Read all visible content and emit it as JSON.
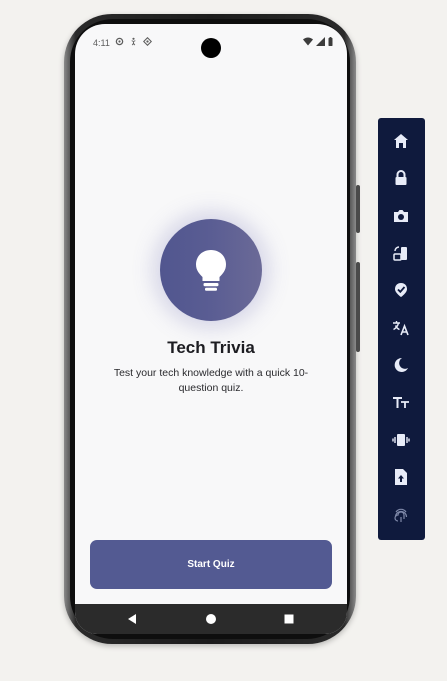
{
  "status_bar": {
    "time": "4:11"
  },
  "app": {
    "title": "Tech Trivia",
    "description": "Test your tech knowledge with a quick 10-question quiz.",
    "start_button_label": "Start Quiz"
  },
  "nav_bar": {
    "buttons": [
      "back-icon",
      "home-icon",
      "recents-icon"
    ]
  },
  "emulator_toolbar": {
    "tools": [
      "home-icon",
      "lock-icon",
      "camera-icon",
      "rotate-icon",
      "location-icon",
      "translate-icon",
      "dark-mode-icon",
      "font-size-icon",
      "vibrate-icon",
      "file-upload-icon",
      "fingerprint-icon"
    ]
  },
  "colors": {
    "accent": "#535a92",
    "toolbar_bg": "#0f1a3d",
    "screen_bg": "#f8f8f9"
  }
}
